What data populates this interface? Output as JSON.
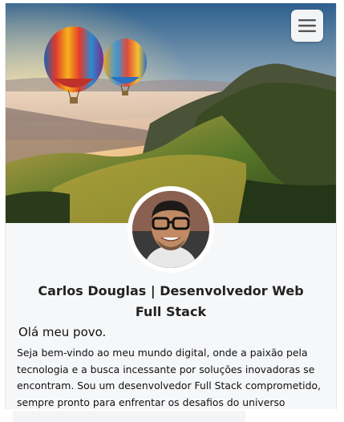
{
  "header": {
    "menu_icon": "hamburger-menu-icon"
  },
  "cover": {
    "description_icon": "cover-image"
  },
  "profile": {
    "avatar_icon": "avatar",
    "title": "Carlos Douglas | Desenvolvedor Web Full Stack",
    "greeting": "Olá meu povo.",
    "bio": "Seja bem-vindo ao meu mundo digital, onde a paixão pela tecnologia e a busca incessante por soluções inovadoras se encontram. Sou um desenvolvedor Full Stack comprometido, sempre pronto para enfrentar os desafios do universo"
  },
  "colors": {
    "card_background": "#f6f7f9",
    "text": "#111111",
    "menu_button": "#f3f4f6"
  }
}
